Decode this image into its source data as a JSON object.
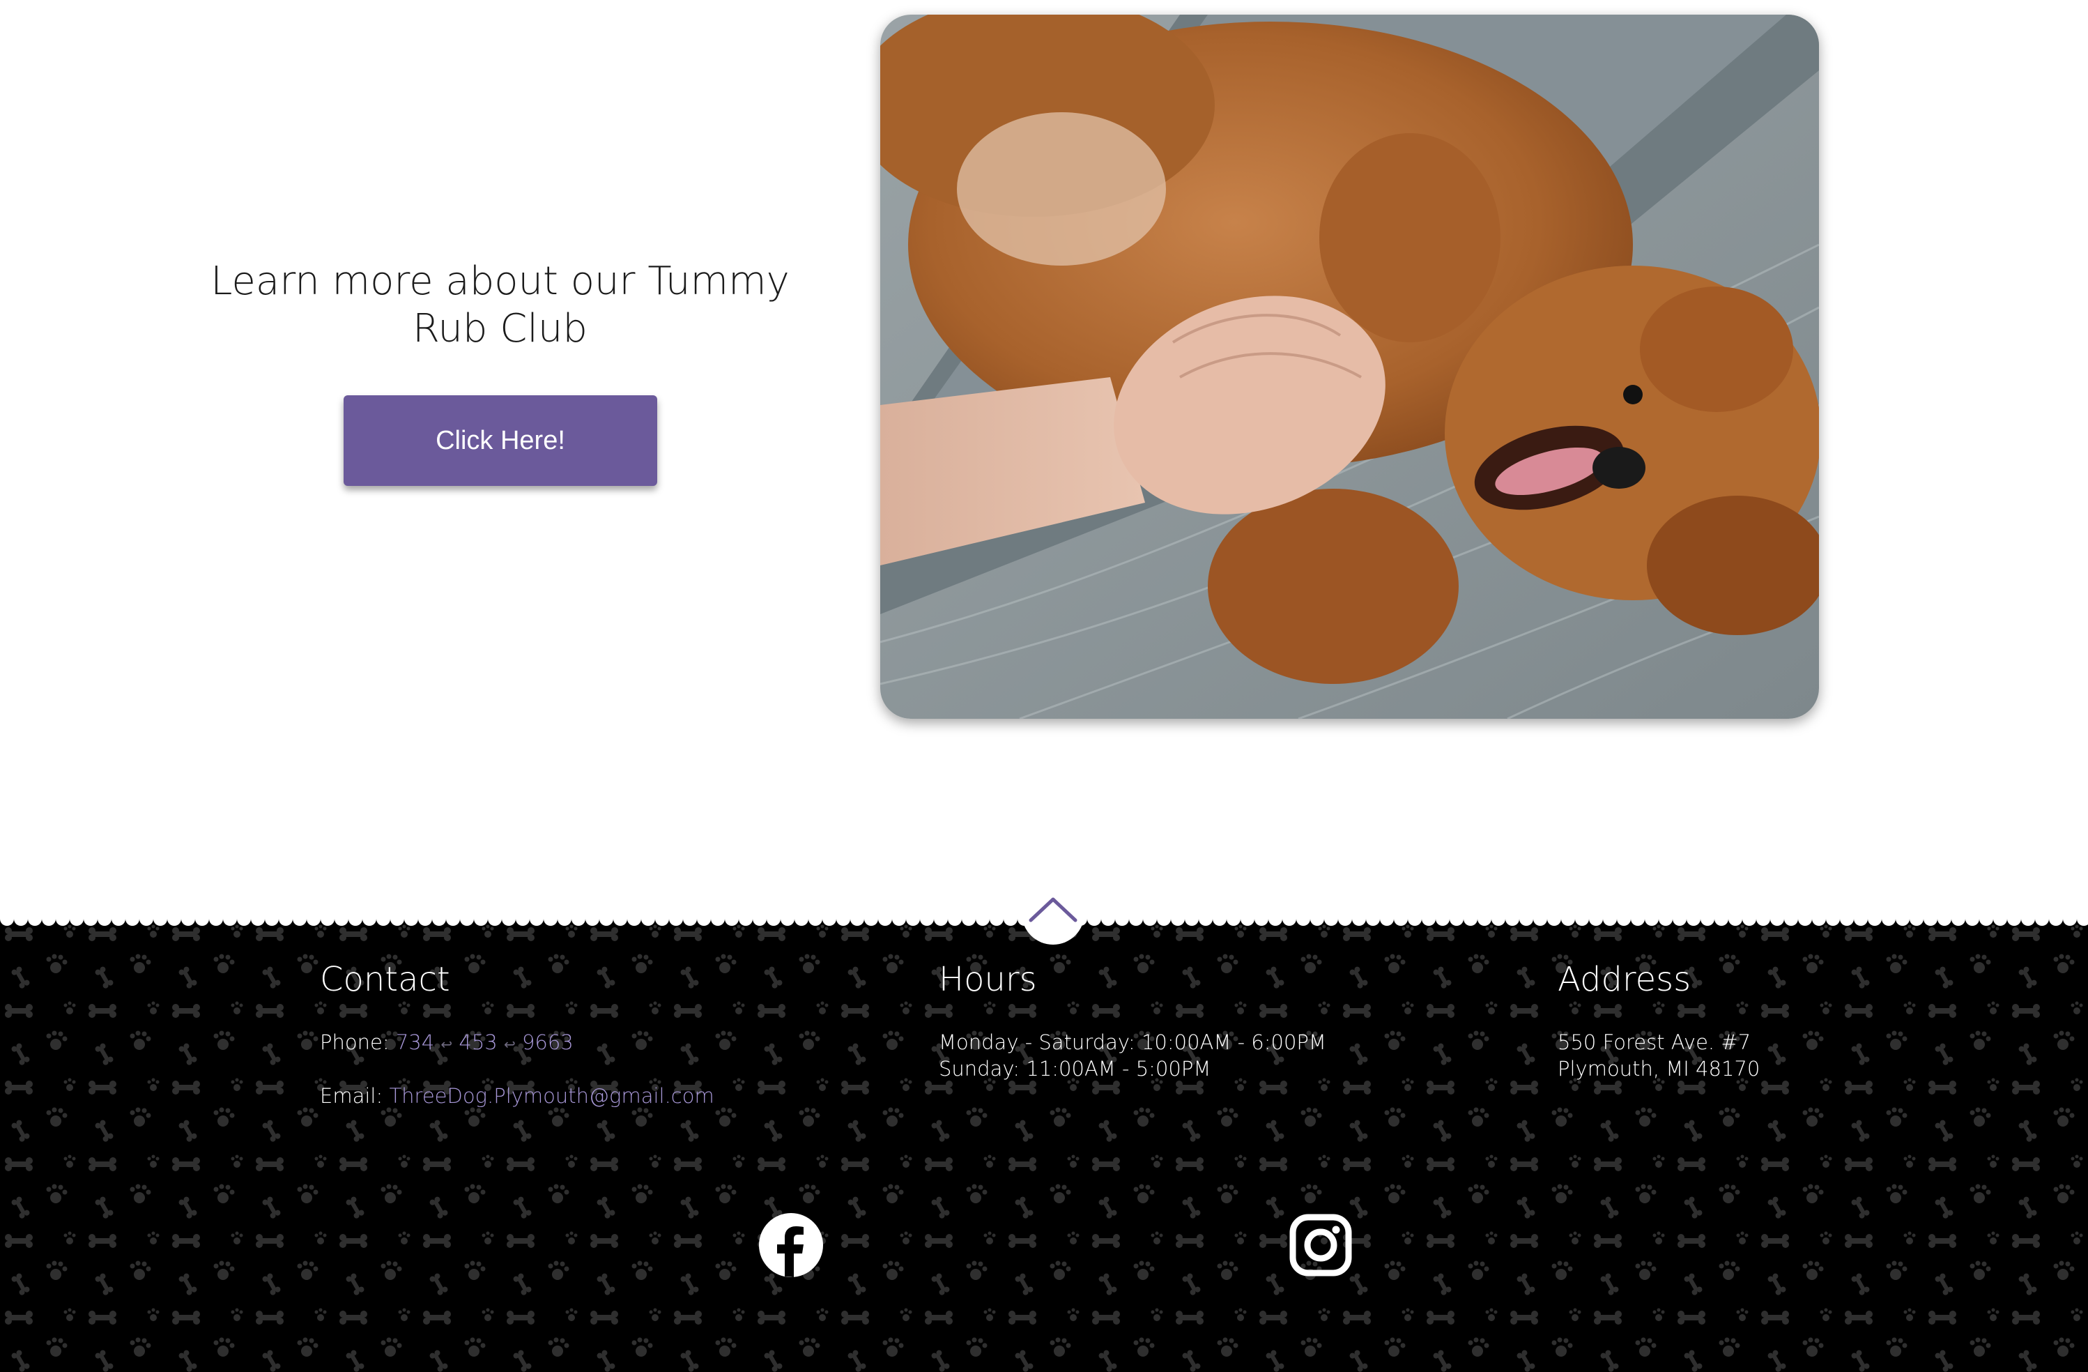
{
  "promo": {
    "heading_line1": "Learn more about our Tummy",
    "heading_line2": "Rub Club",
    "button_label": "Click Here!",
    "button_color": "#6b5a9b"
  },
  "photo": {
    "description_icon": "dog-belly-rub-photo"
  },
  "footer": {
    "scroll_top_icon": "chevron-up-icon",
    "contact": {
      "title": "Contact",
      "phone_label": "Phone: ",
      "phone_part1": "734",
      "phone_part2": "453",
      "phone_part3": "9663",
      "email_label": "Email: ",
      "email": "ThreeDog.Plymouth@gmail.com"
    },
    "hours": {
      "title": "Hours",
      "line1": "Monday - Saturday: 10:00AM - 6:00PM",
      "line2": "Sunday: 11:00AM - 5:00PM"
    },
    "address": {
      "title": "Address",
      "line1": "550 Forest Ave. #7",
      "line2": "Plymouth, MI 48170"
    },
    "social": {
      "facebook_icon": "facebook-icon",
      "instagram_icon": "instagram-icon"
    },
    "link_color": "#a898d8"
  }
}
